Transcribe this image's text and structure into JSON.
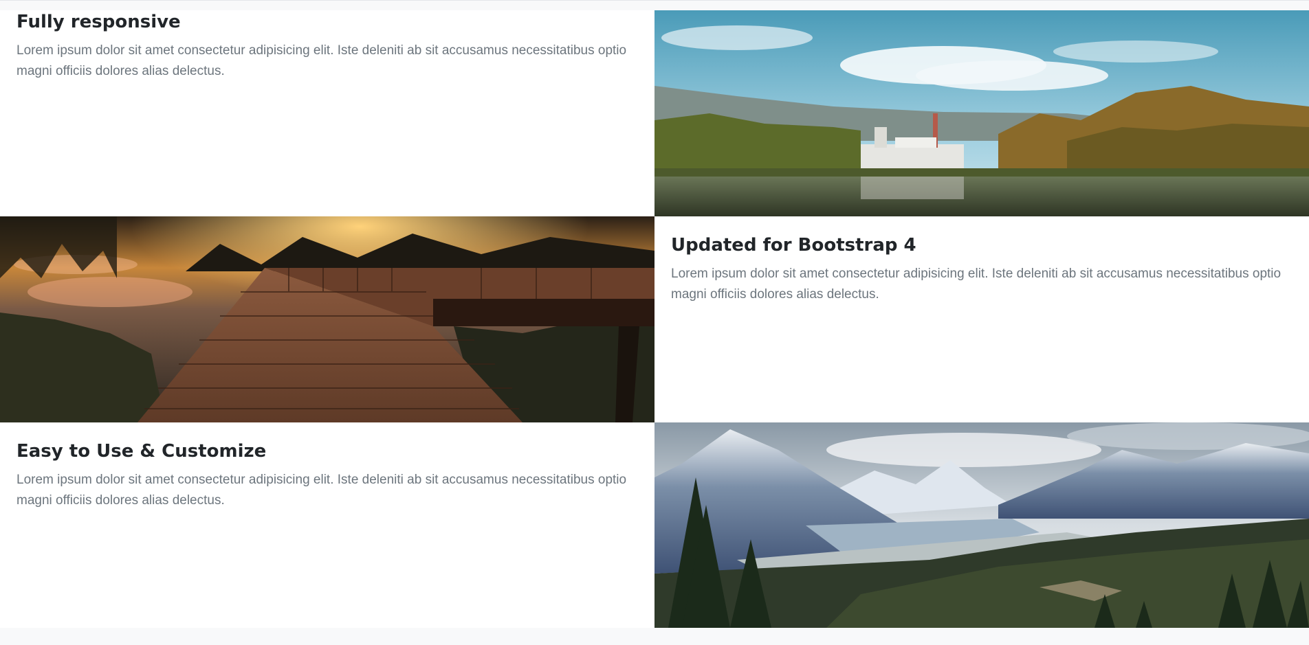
{
  "showcase": {
    "items": [
      {
        "heading": "Fully responsive",
        "body": "Lorem ipsum dolor sit amet consectetur adipisicing elit. Iste deleniti ab sit accusamus necessitatibus optio magni officiis dolores alias delectus."
      },
      {
        "heading": "Updated for Bootstrap 4",
        "body": "Lorem ipsum dolor sit amet consectetur adipisicing elit. Iste deleniti ab sit accusamus necessitatibus optio magni officiis dolores alias delectus."
      },
      {
        "heading": "Easy to Use & Customize",
        "body": "Lorem ipsum dolor sit amet consectetur adipisicing elit. Iste deleniti ab sit accusamus necessitatibus optio magni officiis dolores alias delectus."
      }
    ],
    "images": [
      {
        "subject": "lake with factory and autumn trees"
      },
      {
        "subject": "wooden dock at sunset"
      },
      {
        "subject": "mountain valley with pine trees"
      }
    ]
  },
  "colors": {
    "heading": "#212529",
    "body_text": "#6c757d",
    "page_background": "#f8f9fa",
    "section_background": "#ffffff"
  }
}
